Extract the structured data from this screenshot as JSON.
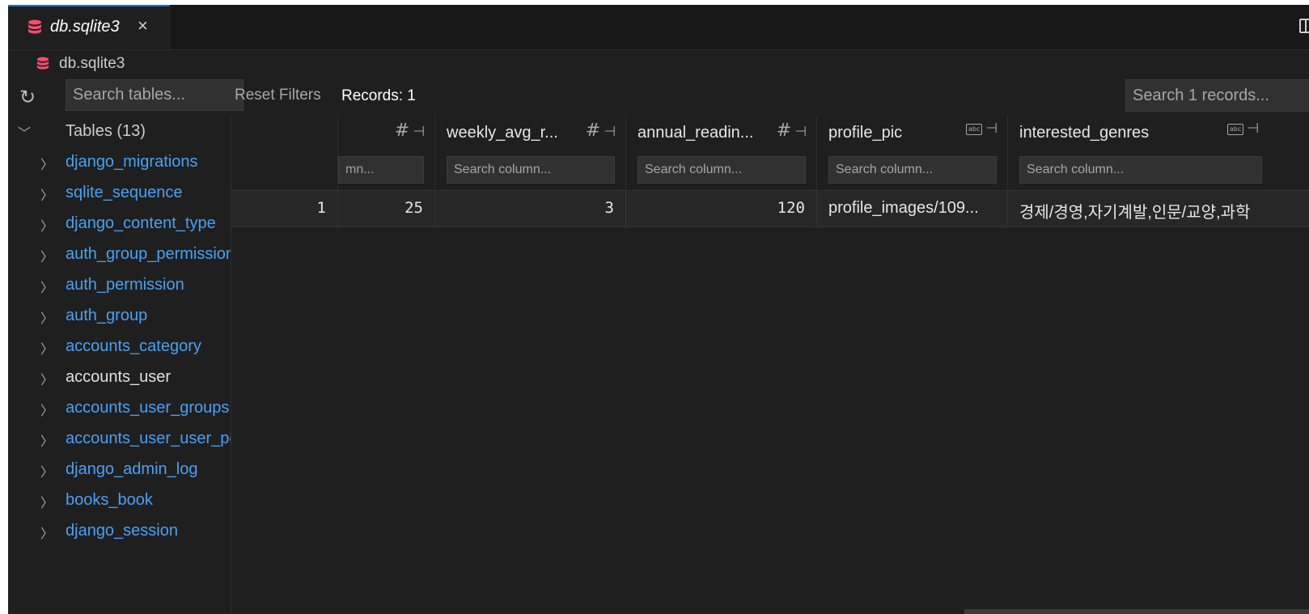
{
  "tab": {
    "title": "db.sqlite3",
    "close": "×"
  },
  "breadcrumb": {
    "label": "db.sqlite3"
  },
  "toolbar": {
    "search_tables_placeholder": "Search tables...",
    "reset_filters": "Reset Filters",
    "records": "Records: 1",
    "search_records_placeholder": "Search 1 records..."
  },
  "sidebar": {
    "header": "Tables (13)",
    "items": [
      {
        "label": "django_migrations"
      },
      {
        "label": "sqlite_sequence"
      },
      {
        "label": "django_content_type"
      },
      {
        "label": "auth_group_permissions"
      },
      {
        "label": "auth_permission"
      },
      {
        "label": "auth_group"
      },
      {
        "label": "accounts_category"
      },
      {
        "label": "accounts_user"
      },
      {
        "label": "accounts_user_groups"
      },
      {
        "label": "accounts_user_user_permissions"
      },
      {
        "label": "django_admin_log"
      },
      {
        "label": "books_book"
      },
      {
        "label": "django_session"
      }
    ]
  },
  "grid": {
    "columns": [
      {
        "name": "",
        "type": ""
      },
      {
        "name": "",
        "type": "number",
        "search_value": "mn..."
      },
      {
        "name": "weekly_avg_r...",
        "type": "number",
        "search_placeholder": "Search column..."
      },
      {
        "name": "annual_readin...",
        "type": "number",
        "search_placeholder": "Search column..."
      },
      {
        "name": "profile_pic",
        "type": "text",
        "search_placeholder": "Search column..."
      },
      {
        "name": "interested_genres",
        "type": "text",
        "search_placeholder": "Search column..."
      }
    ],
    "row": [
      "1",
      "25",
      "3",
      "120",
      "profile_images/109...",
      "경제/경영,자기계발,인문/교양,과학"
    ]
  },
  "colors": {
    "link": "#4aa0f4",
    "accent": "#0078d4",
    "db_icon": "#f0506e"
  }
}
